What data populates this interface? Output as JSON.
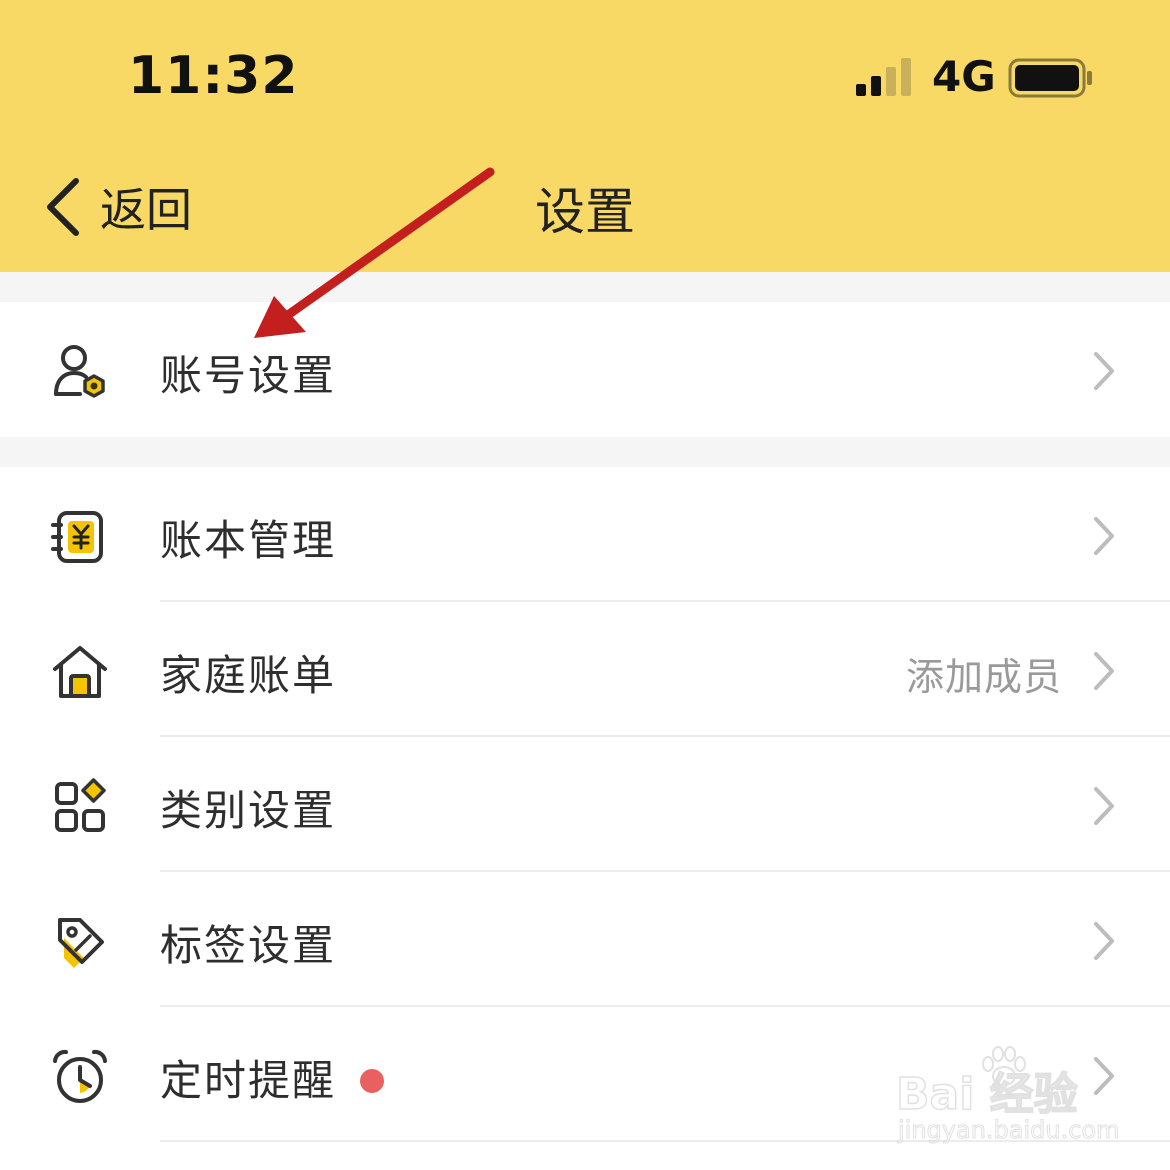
{
  "status_bar": {
    "time": "11:32",
    "network": "4G"
  },
  "nav": {
    "back_label": "返回",
    "title": "设置"
  },
  "menu": [
    {
      "label": "账号设置",
      "icon": "user-settings-icon"
    },
    {
      "label": "账本管理",
      "icon": "ledger-yen-icon"
    },
    {
      "label": "家庭账单",
      "icon": "home-icon",
      "extra": "添加成员"
    },
    {
      "label": "类别设置",
      "icon": "category-grid-icon"
    },
    {
      "label": "标签设置",
      "icon": "tag-icon"
    },
    {
      "label": "定时提醒",
      "icon": "alarm-clock-icon",
      "badge": "red-dot"
    }
  ],
  "watermark": {
    "main": "Bai 经验",
    "sub": "jingyan.baidu.com"
  },
  "colors": {
    "header": "#f8d966",
    "accent": "#f5c400",
    "badge": "#e8605f",
    "arrow": "#c41f1f"
  }
}
